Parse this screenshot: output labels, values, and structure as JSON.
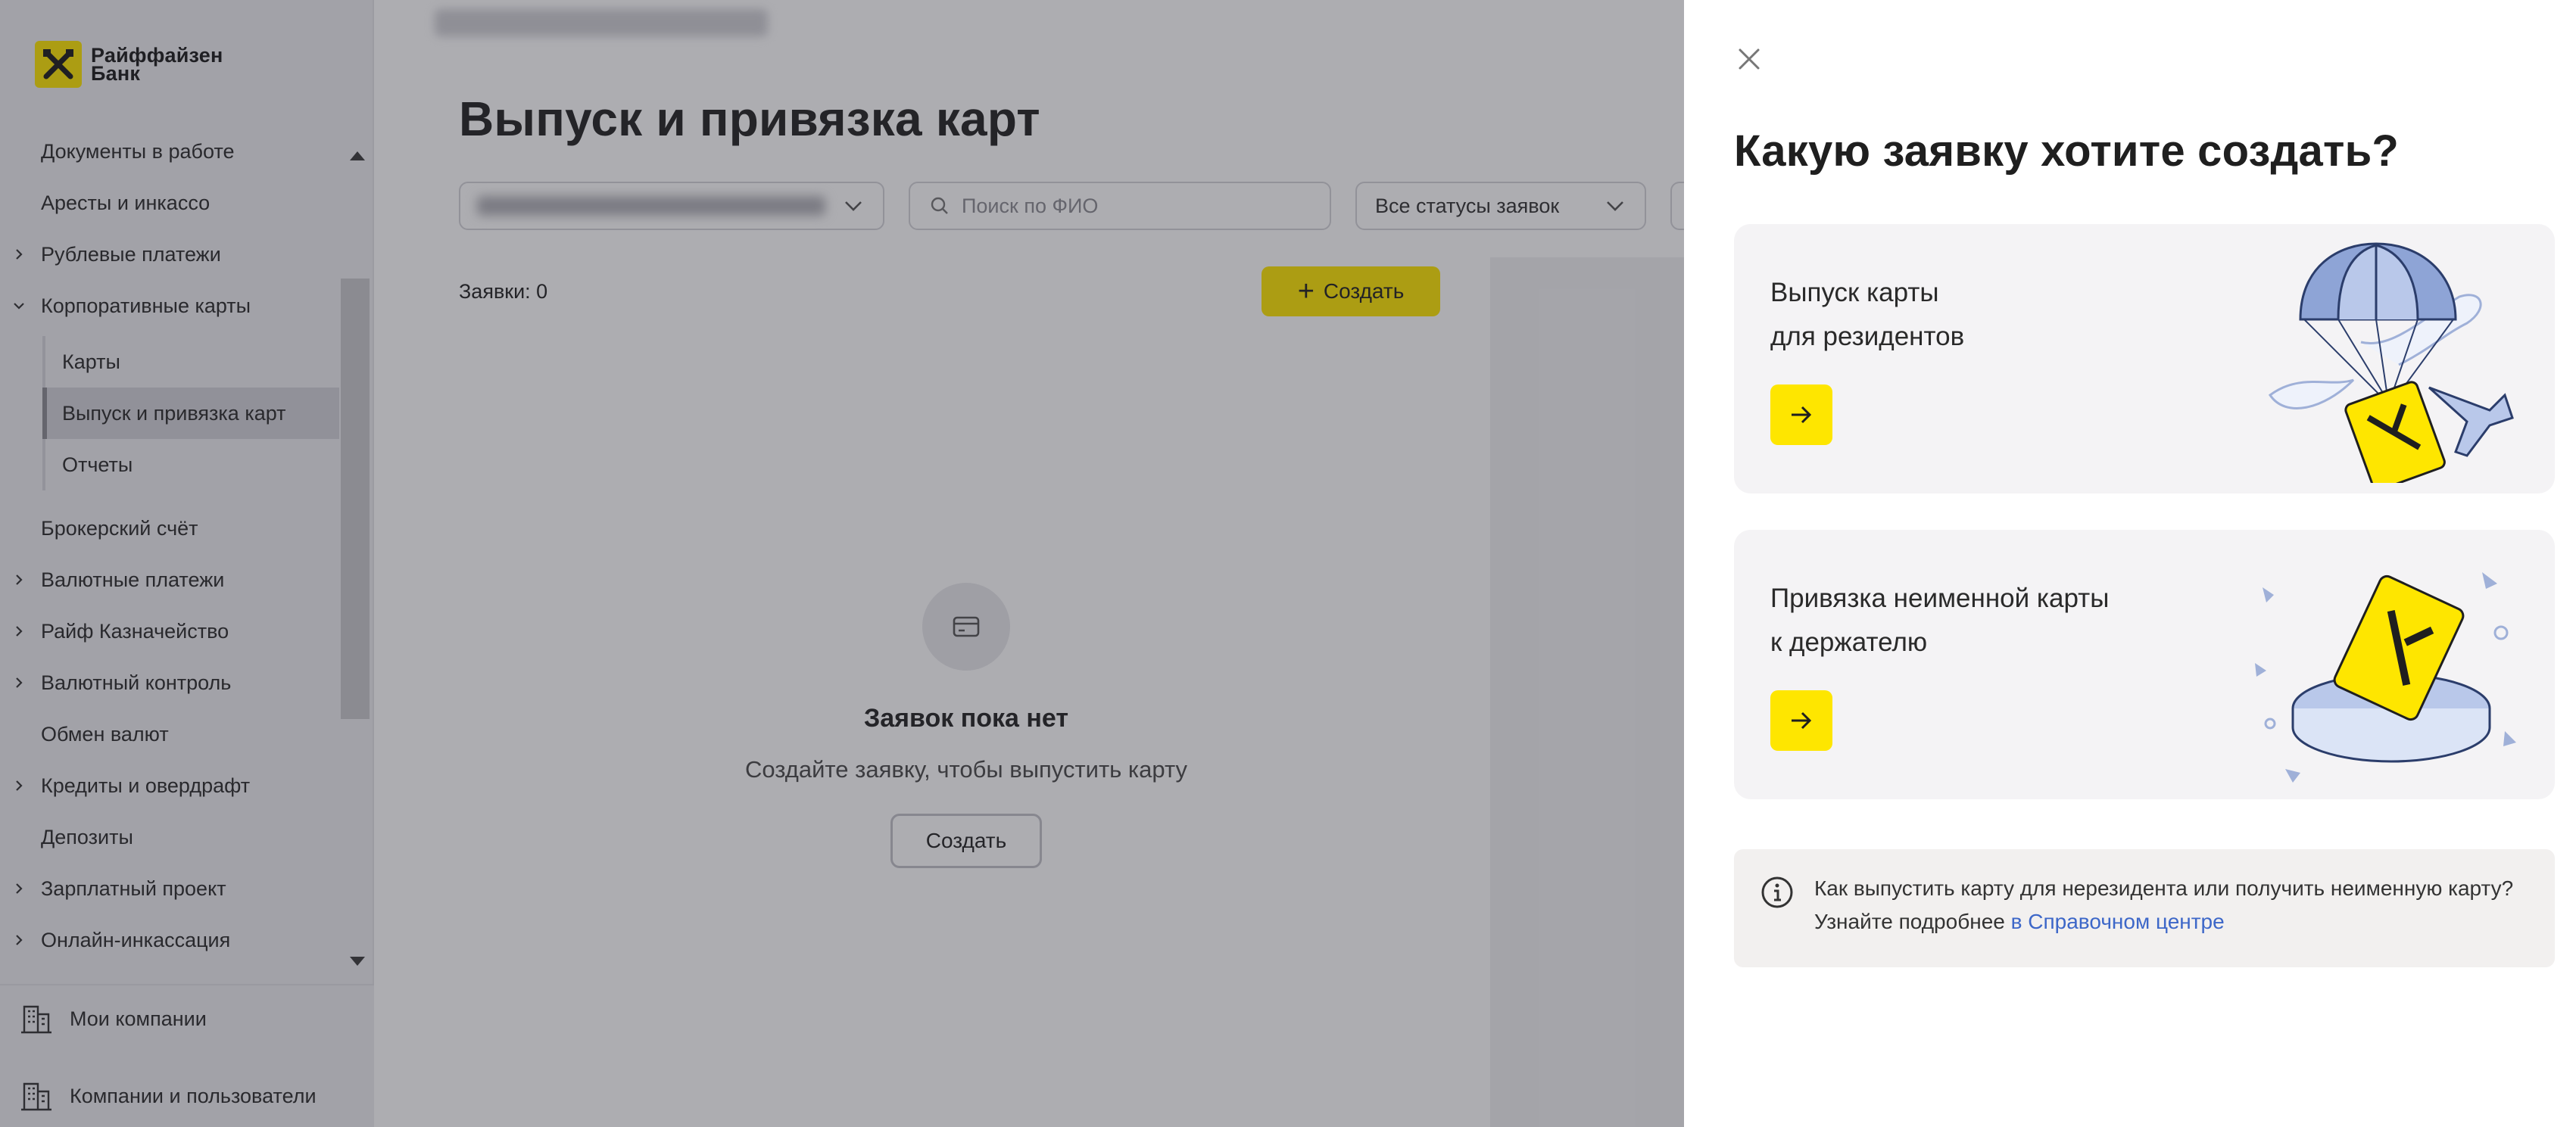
{
  "brand": {
    "name_line1": "Райффайзен",
    "name_line2": "Банк",
    "accent": "#fee600"
  },
  "sidebar": {
    "items": [
      {
        "label": "Документы в работе",
        "expandable": false
      },
      {
        "label": "Аресты и инкассо",
        "expandable": false
      },
      {
        "label": "Рублевые платежи",
        "expandable": true
      },
      {
        "label": "Корпоративные карты",
        "expandable": true,
        "expanded": true
      }
    ],
    "subitems": [
      {
        "label": "Карты",
        "active": false
      },
      {
        "label": "Выпуск и привязка карт",
        "active": true
      },
      {
        "label": "Отчеты",
        "active": false
      }
    ],
    "items_after": [
      {
        "label": "Брокерский счёт",
        "expandable": false
      },
      {
        "label": "Валютные платежи",
        "expandable": true
      },
      {
        "label": "Райф Казначейство",
        "expandable": true
      },
      {
        "label": "Валютный контроль",
        "expandable": true
      },
      {
        "label": "Обмен валют",
        "expandable": false
      },
      {
        "label": "Кредиты и овердрафт",
        "expandable": true
      },
      {
        "label": "Депозиты",
        "expandable": false
      },
      {
        "label": "Зарплатный проект",
        "expandable": true
      },
      {
        "label": "Онлайн-инкассация",
        "expandable": true
      }
    ],
    "footer": {
      "companies": "Мои компании",
      "users": "Компании и пользователи"
    }
  },
  "main": {
    "title": "Выпуск и привязка карт",
    "search_placeholder": "Поиск по ФИО",
    "status_filter": "Все статусы заявок",
    "count_label": "Заявки: 0",
    "create_label": "Создать",
    "empty": {
      "title": "Заявок пока нет",
      "subtitle": "Создайте заявку, чтобы выпустить карту",
      "button": "Создать"
    }
  },
  "drawer": {
    "title": "Какую заявку хотите создать?",
    "cards": [
      {
        "title": "Выпуск карты\nдля резидентов",
        "illustration": "parachute-card-illustration"
      },
      {
        "title": "Привязка неименной карты\n к держателю",
        "illustration": "card-on-pedestal-illustration"
      }
    ],
    "info": {
      "text": "Как выпустить карту для нерезидента или получить неименную карту? Узнайте подробнее ",
      "link": "в Справочном центре"
    }
  }
}
